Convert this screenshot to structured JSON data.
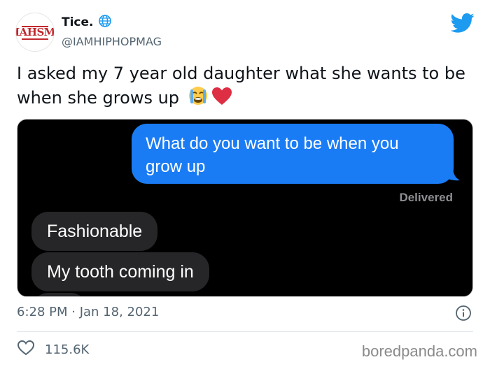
{
  "tweet": {
    "avatar_logo": "IAHSM",
    "display_name": "Tice.",
    "handle": "@IAMHIPHOPMAG",
    "text": "I asked my 7 year old daughter what she wants to be when she grows up",
    "emojis": [
      "crying-face",
      "red-heart"
    ],
    "timestamp": "6:28 PM · Jan 18, 2021",
    "likes": "115.6K"
  },
  "conversation": {
    "sent_message": "What do you want to be when you grow up",
    "status": "Delivered",
    "received_messages": [
      "Fashionable",
      "My tooth coming in"
    ]
  },
  "colors": {
    "brand": "#1d9bf0",
    "sent_bubble": "#1a7cf5",
    "received_bubble": "#262628"
  },
  "watermark": "boredpanda.com"
}
